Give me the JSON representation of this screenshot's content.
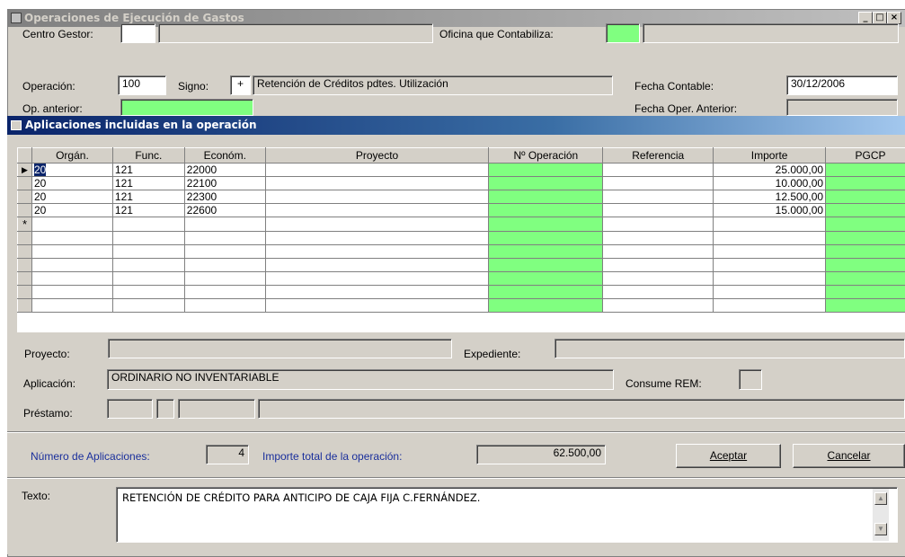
{
  "window": {
    "title": "Operaciones de Ejecución de Gastos",
    "controls": [
      "_",
      "□",
      "×"
    ]
  },
  "header": {
    "centro_gestor_label": "Centro Gestor:",
    "centro_gestor_code": "",
    "centro_gestor_name": "",
    "oficina_label": "Oficina que Contabiliza:",
    "oficina_code": "",
    "oficina_name": "",
    "operacion_label": "Operación:",
    "operacion_value": "100",
    "signo_label": "Signo:",
    "signo_value": "+",
    "operacion_desc": "Retención de Créditos pdtes. Utilización",
    "fecha_contable_label": "Fecha Contable:",
    "fecha_contable_value": "30/12/2006",
    "op_anterior_label": "Op. anterior:",
    "fecha_oper_anterior_label": "Fecha Oper. Anterior:"
  },
  "dialog": {
    "title": "Aplicaciones incluidas en la operación",
    "grid": {
      "columns": [
        "Orgán.",
        "Func.",
        "Económ.",
        "Proyecto",
        "Nº Operación",
        "Referencia",
        "Importe",
        "PGCP"
      ],
      "rows": [
        {
          "organo": "20",
          "func": "121",
          "econom": "22000",
          "proyecto": "",
          "n_operacion": "",
          "referencia": "",
          "importe": "25.000,00",
          "pgcp": ""
        },
        {
          "organo": "20",
          "func": "121",
          "econom": "22100",
          "proyecto": "",
          "n_operacion": "",
          "referencia": "",
          "importe": "10.000,00",
          "pgcp": ""
        },
        {
          "organo": "20",
          "func": "121",
          "econom": "22300",
          "proyecto": "",
          "n_operacion": "",
          "referencia": "",
          "importe": "12.500,00",
          "pgcp": ""
        },
        {
          "organo": "20",
          "func": "121",
          "econom": "22600",
          "proyecto": "",
          "n_operacion": "",
          "referencia": "",
          "importe": "15.000,00",
          "pgcp": ""
        }
      ],
      "new_row_marker": "*",
      "current_row_marker": "▶"
    },
    "proyecto_label": "Proyecto:",
    "expediente_label": "Expediente:",
    "aplicacion_label": "Aplicación:",
    "aplicacion_value": "ORDINARIO NO INVENTARIABLE",
    "consume_rem_label": "Consume REM:",
    "prestamo_label": "Préstamo:",
    "num_aplicaciones_label": "Número de Aplicaciones:",
    "num_aplicaciones_value": "4",
    "importe_total_label": "Importe total de la operación:",
    "importe_total_value": "62.500,00",
    "aceptar_label": "Aceptar",
    "cancelar_label": "Cancelar",
    "texto_label": "Texto:",
    "texto_value": "RETENCIÓN DE CRÉDITO PARA ANTICIPO DE CAJA FIJA C.FERNÁNDEZ."
  },
  "colors": {
    "green_field": "#80ff80",
    "dialog_title": "#0a246a",
    "blue_label": "#1a2f9c"
  }
}
